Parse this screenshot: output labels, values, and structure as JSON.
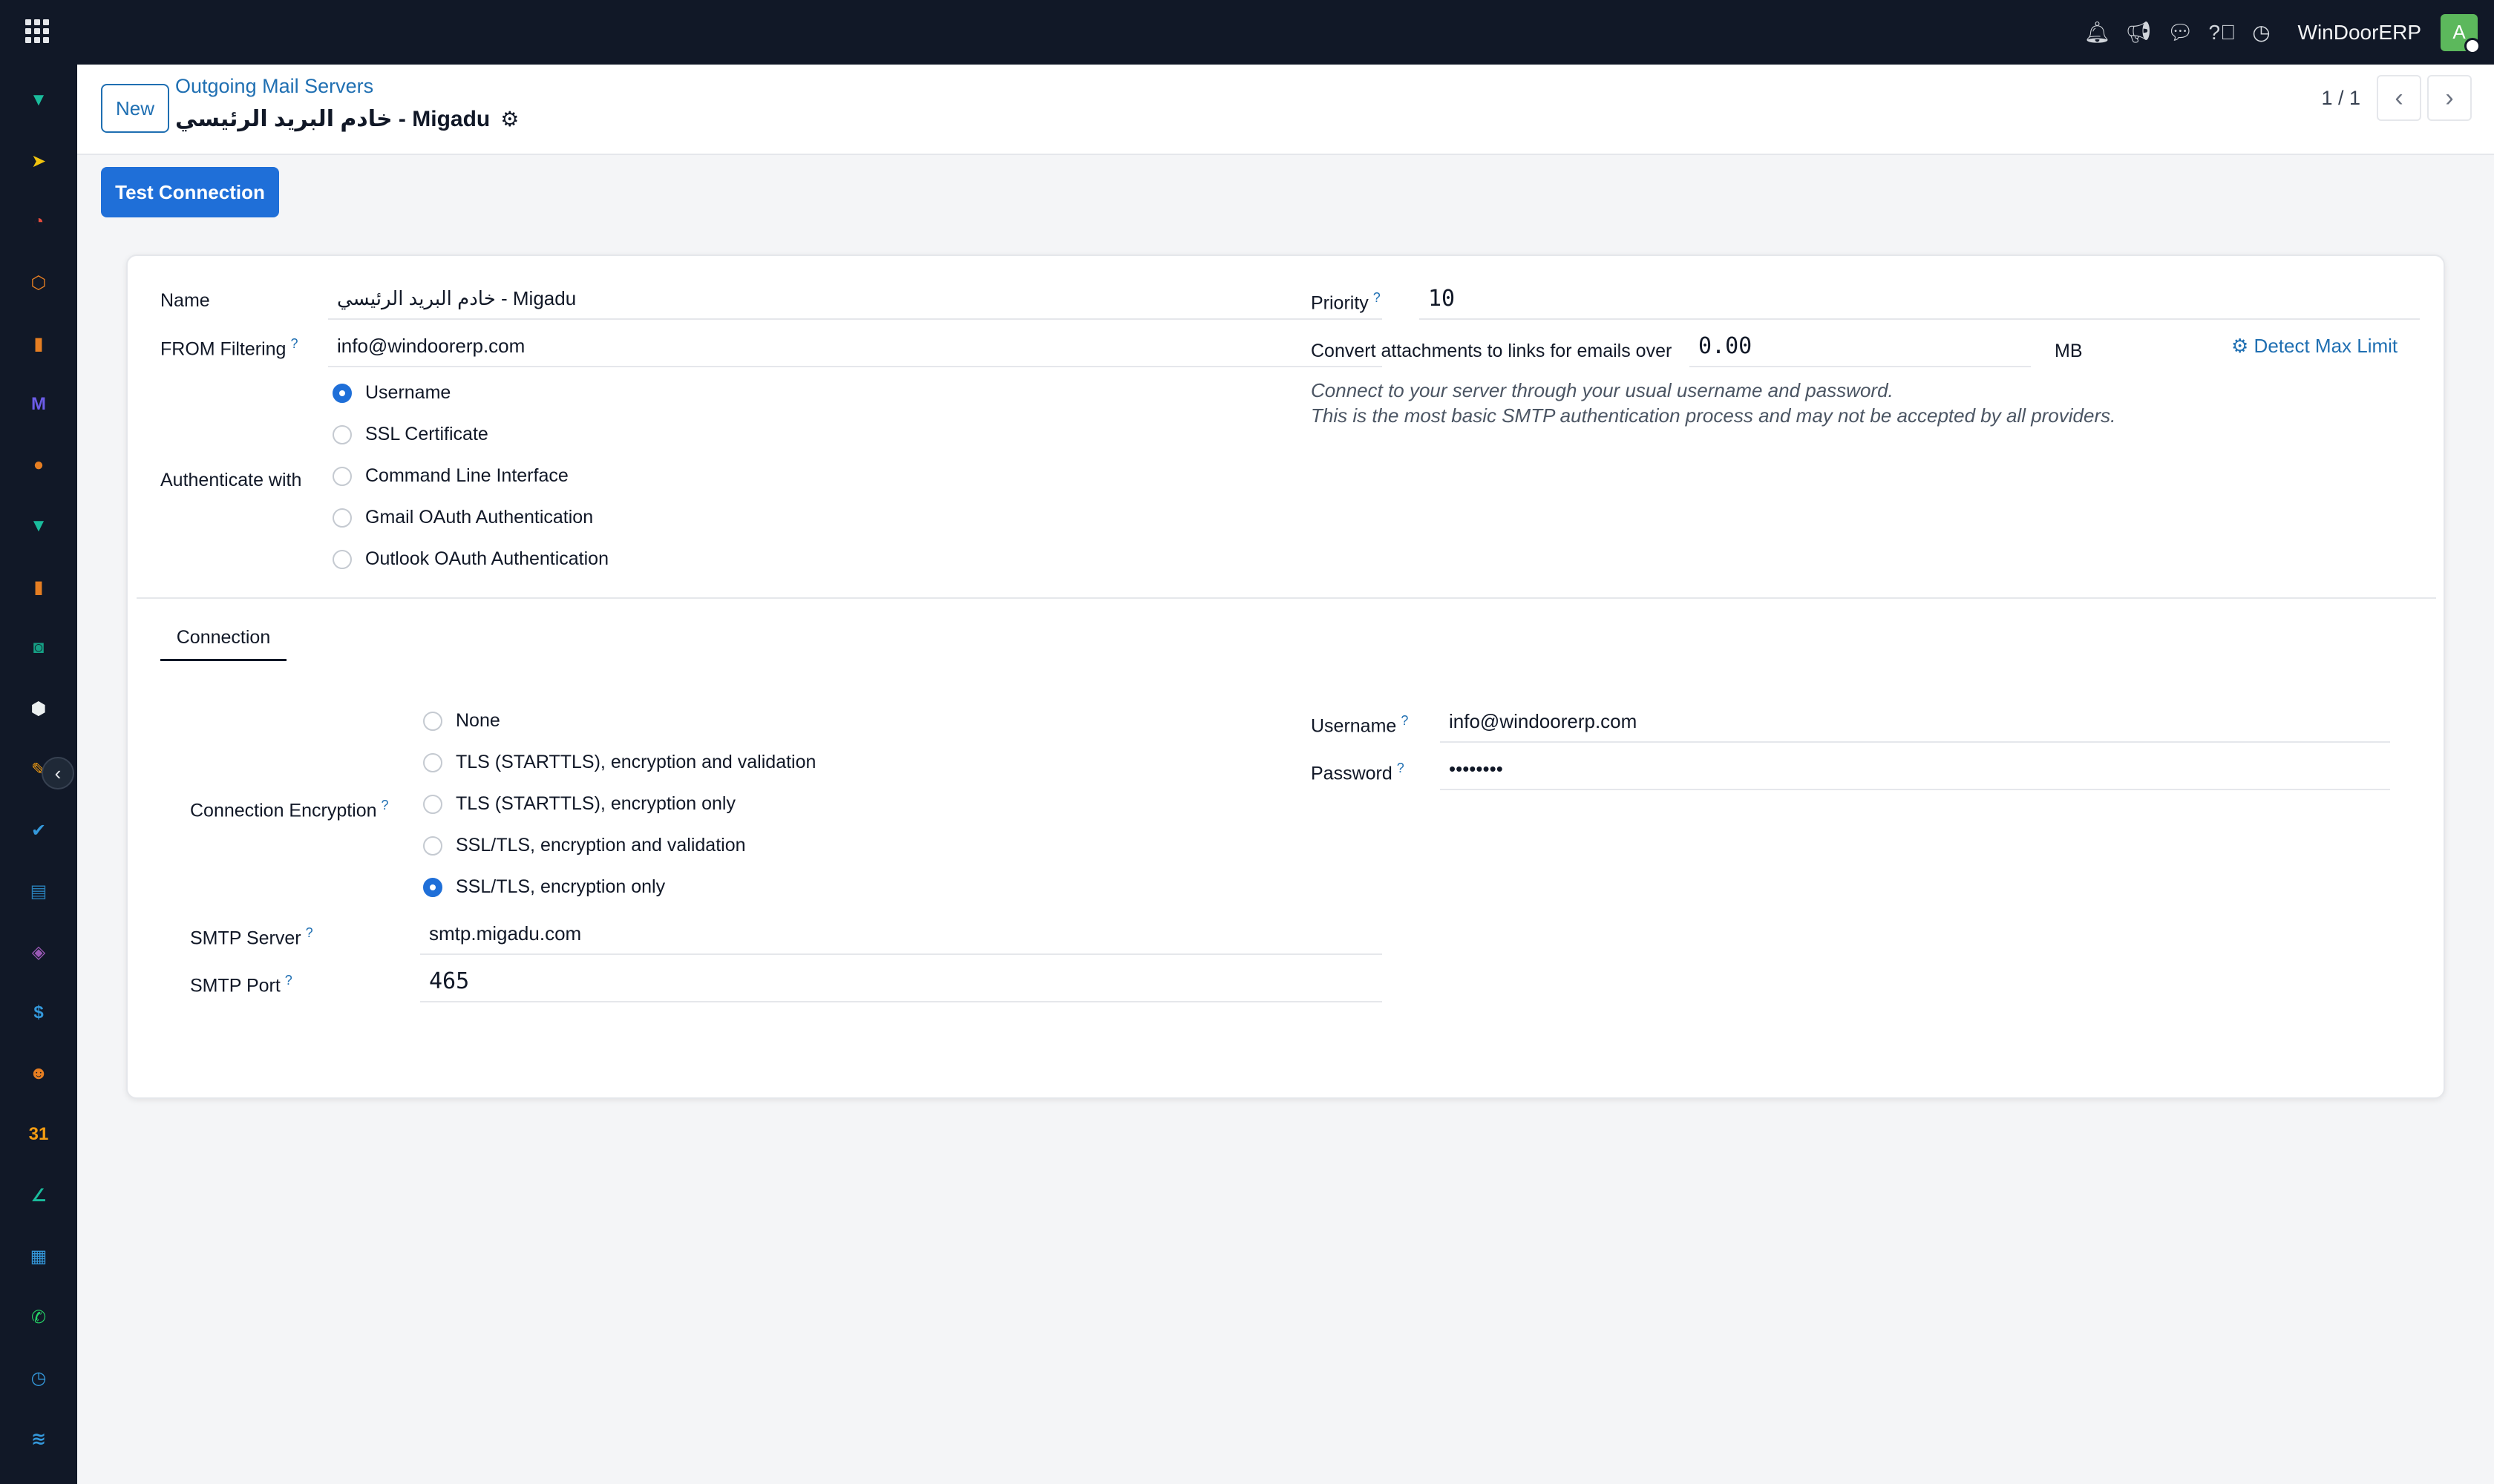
{
  "navbar": {
    "company": "WinDoorERP",
    "avatar_initial": "A",
    "icons": [
      "bell-icon",
      "megaphone-icon",
      "chat-icon",
      "help-icon",
      "clock-icon"
    ]
  },
  "sidebar": {
    "apps": [
      {
        "name": "discuss-app",
        "color": "#1abc9c",
        "glyph": "▼"
      },
      {
        "name": "send-app",
        "color": "#f1c40f",
        "glyph": "➤"
      },
      {
        "name": "dashboard-app",
        "color": "#e74c3c",
        "glyph": "◔"
      },
      {
        "name": "inventory-app",
        "color": "#e67e22",
        "glyph": "⬡"
      },
      {
        "name": "reports-app",
        "color": "#e67e22",
        "glyph": "▮"
      },
      {
        "name": "mail-app",
        "color": "#6c5ce7",
        "glyph": "M"
      },
      {
        "name": "live-chat-app",
        "color": "#e67e22",
        "glyph": "●"
      },
      {
        "name": "project-app",
        "color": "#1abc9c",
        "glyph": "▼"
      },
      {
        "name": "accounting-app",
        "color": "#e67e22",
        "glyph": "▮"
      },
      {
        "name": "contacts-app",
        "color": "#16a085",
        "glyph": "◙"
      },
      {
        "name": "product-app",
        "color": "#ecf0f1",
        "glyph": "⬢"
      },
      {
        "name": "studio-app",
        "color": "#f39c12",
        "glyph": "✎"
      },
      {
        "name": "todo-app",
        "color": "#3498db",
        "glyph": "✔"
      },
      {
        "name": "knowledge-app",
        "color": "#2980b9",
        "glyph": "▤"
      },
      {
        "name": "apps-store-app",
        "color": "#9b59b6",
        "glyph": "◈"
      },
      {
        "name": "payroll-app",
        "color": "#3498db",
        "glyph": "$"
      },
      {
        "name": "employees-app",
        "color": "#e67e22",
        "glyph": "☻"
      },
      {
        "name": "calendar-app",
        "color": "#f39c12",
        "glyph": "31"
      },
      {
        "name": "sign-app",
        "color": "#1abc9c",
        "glyph": "∠"
      },
      {
        "name": "dashboards-app",
        "color": "#3498db",
        "glyph": "▦"
      },
      {
        "name": "whatsapp-app",
        "color": "#25d366",
        "glyph": "✆"
      },
      {
        "name": "timer-app",
        "color": "#3498db",
        "glyph": "◷"
      },
      {
        "name": "website-app",
        "color": "#3498db",
        "glyph": "≋"
      }
    ]
  },
  "control_panel": {
    "new_label": "New",
    "breadcrumb": "Outgoing Mail Servers",
    "record_title": "خادم البريد الرئيسي - Migadu",
    "pager": "1 / 1",
    "prev": "‹",
    "next": "›"
  },
  "actions": {
    "test_connection": "Test Connection"
  },
  "form": {
    "name_label": "Name",
    "name_value": "خادم البريد الرئيسي - Migadu",
    "from_filter_label": "FROM Filtering",
    "from_filter_value": "info@windoorerp.com",
    "auth_label": "Authenticate with",
    "auth_options": [
      {
        "label": "Username",
        "checked": true
      },
      {
        "label": "SSL Certificate",
        "checked": false
      },
      {
        "label": "Command Line Interface",
        "checked": false
      },
      {
        "label": "Gmail OAuth Authentication",
        "checked": false
      },
      {
        "label": "Outlook OAuth Authentication",
        "checked": false
      }
    ],
    "priority_label": "Priority",
    "priority_value": "10",
    "attach_label": "Convert attachments to links for emails over",
    "attach_value": "0.00",
    "attach_unit": "MB",
    "detect_max_limit": "Detect Max Limit",
    "auth_help_1": "Connect to your server through your usual username and password.",
    "auth_help_2": "This is the most basic SMTP authentication process and may not be accepted by all providers.",
    "help_mark": "?"
  },
  "tabs": {
    "connection": "Connection"
  },
  "connection": {
    "encryption_label": "Connection Encryption",
    "encryption_options": [
      {
        "label": "None",
        "checked": false
      },
      {
        "label": "TLS (STARTTLS), encryption and validation",
        "checked": false
      },
      {
        "label": "TLS (STARTTLS), encryption only",
        "checked": false
      },
      {
        "label": "SSL/TLS, encryption and validation",
        "checked": false
      },
      {
        "label": "SSL/TLS, encryption only",
        "checked": true
      }
    ],
    "smtp_server_label": "SMTP Server",
    "smtp_server_value": "smtp.migadu.com",
    "smtp_port_label": "SMTP Port",
    "smtp_port_value": "465",
    "username_label": "Username",
    "username_value": "info@windoorerp.com",
    "password_label": "Password",
    "password_value": "••••••••"
  }
}
